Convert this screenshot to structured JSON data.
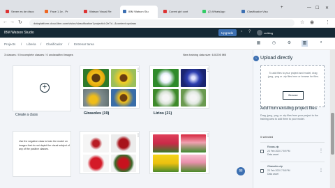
{
  "browser": {
    "tabs": [
      {
        "label": "Seven es de disco"
      },
      {
        "label": "Face 1.1e - Pr"
      },
      {
        "label": "Watson Visual Re"
      },
      {
        "label": "IBM Watson Stu"
      },
      {
        "label": "Curent girl cont"
      },
      {
        "label": "(2) WhatsApp"
      },
      {
        "label": "Clasificador Visu"
      }
    ],
    "url": "dataplatform.cloud.ibm.com/vision/classification?projectid=2e7d...&context=cpdaas"
  },
  "app": {
    "name": "IBM Watson Studio",
    "upgrade_label": "Upgrade",
    "username": "redking"
  },
  "breadcrumb": [
    "Projects",
    "Liberia",
    "Clasificador",
    "Entrenar tarea"
  ],
  "status": {
    "classes_summary": "3 classes / 0 incomplete classes / 0 unclassified images",
    "training_size": "New training data size: 6.0/200 MB"
  },
  "cards": {
    "create_label": "Create a class",
    "negative_text": "Use the negative class to train the model on images that do not depict the visual subject of any of the positive classes."
  },
  "classes": [
    {
      "title": "Girasoles (19)"
    },
    {
      "title": "Lirios (21)"
    },
    {
      "title": ""
    },
    {
      "title": ""
    }
  ],
  "panel": {
    "title": "Upload directly",
    "dropzone_text": "To add files to your project and model, drag .jpeg, .png or .zip files here or browse for files.",
    "browse_label": "Browse",
    "from_title": "Add from existing project files",
    "from_text": "Drag .jpeg, .png, or .zip files from your project to the training area to add them to your model.",
    "selected": "0 selected",
    "files": [
      {
        "name": "Rosas.zip",
        "meta": "23 Feb 2020 7:59 PM",
        "meta2": "Data asset"
      },
      {
        "name": "Girasoles.zip",
        "meta": "23 Feb 2020 7:58 PM",
        "meta2": "Data asset"
      }
    ]
  },
  "colors": {
    "header_bg": "#152935",
    "accent": "#3d70b2"
  },
  "icons": [
    "search-icon",
    "plus-icon",
    "kebab-icon",
    "close-icon",
    "chat-icon"
  ]
}
